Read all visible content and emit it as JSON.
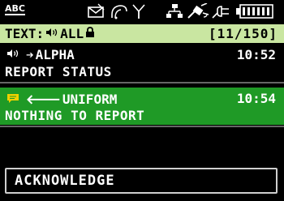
{
  "status_bar": {
    "input_mode": "ABC",
    "icons": [
      "mail-icon",
      "satellite-dish-icon",
      "antenna-icon",
      "network-icon",
      "gps-satellite-icon",
      "power-plug-icon",
      "battery-icon"
    ]
  },
  "header": {
    "title": "TEXT:",
    "filter": "ALL",
    "counter": "[11/150]"
  },
  "messages": [
    {
      "direction": "incoming",
      "sender": "ALPHA",
      "time": "10:52",
      "body": "REPORT STATUS",
      "selected": false
    },
    {
      "direction": "outgoing",
      "sender": "UNIFORM",
      "time": "10:54",
      "body": "NOTHING TO REPORT",
      "selected": true
    }
  ],
  "footer": {
    "action_label": "ACKNOWLEDGE"
  },
  "colors": {
    "header_bg": "#c9e6a1",
    "selected_bg": "#1f9a26",
    "background": "#000000",
    "text": "#ffffff"
  }
}
